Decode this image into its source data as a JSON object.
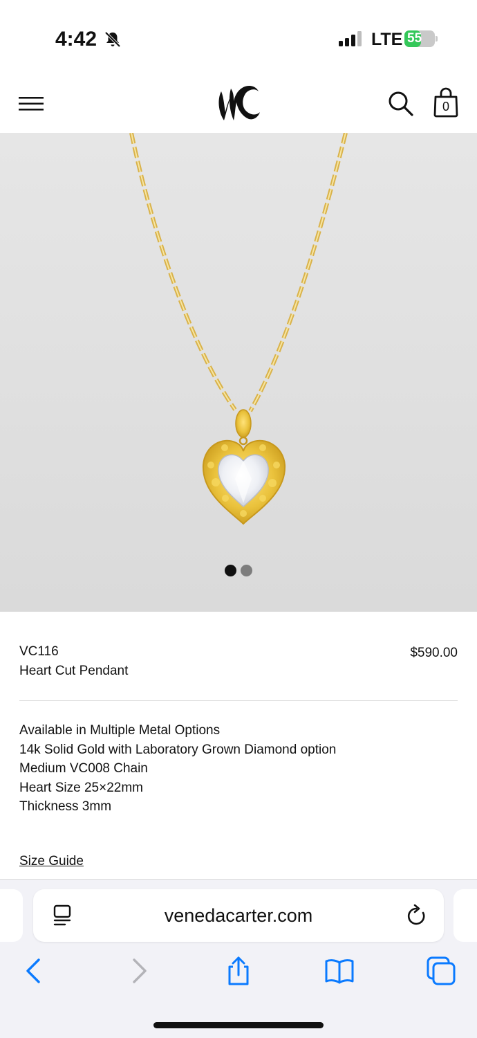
{
  "status_bar": {
    "time": "4:42",
    "network": "LTE",
    "battery_level": "55",
    "battery_fraction": 0.55,
    "icons": [
      "bell-slash-icon",
      "signal-icon",
      "battery-charging-icon"
    ]
  },
  "header": {
    "logo_text": "VC",
    "bag_count": "0",
    "icons": [
      "menu-icon",
      "search-icon",
      "shopping-bag-icon"
    ]
  },
  "gallery": {
    "image_description": "necklace-pendant-image",
    "slide_count": 2,
    "active_slide": 1
  },
  "product": {
    "sku": "VC116",
    "name": "Heart Cut Pendant",
    "price": "$590.00",
    "details": [
      "Available in Multiple Metal Options",
      "14k Solid Gold with Laboratory Grown Diamond option",
      "Medium VC008 Chain",
      "Heart Size 25×22mm",
      "Thickness 3mm"
    ],
    "size_guide_label": "Size Guide"
  },
  "browser": {
    "url": "venedacarter.com",
    "icons": [
      "reader-icon",
      "reload-icon",
      "back-icon",
      "forward-icon",
      "share-icon",
      "bookmarks-icon",
      "tabs-icon"
    ]
  },
  "colors": {
    "accent_blue": "#0a7aff",
    "gold": "#e9c24a",
    "battery_green": "#34c759"
  }
}
